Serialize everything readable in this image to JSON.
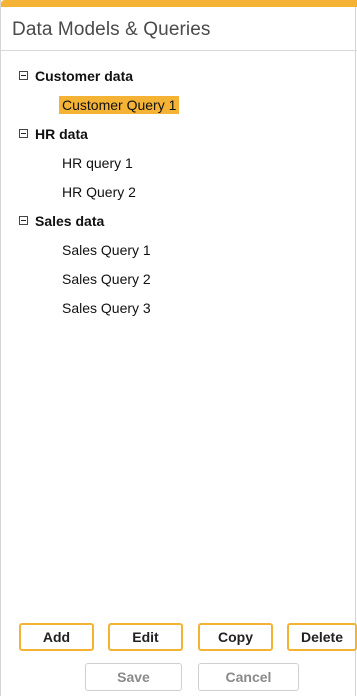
{
  "header": {
    "title": "Data Models & Queries"
  },
  "tree": {
    "groups": [
      {
        "label": "Customer data",
        "expanded": true,
        "items": [
          {
            "label": "Customer Query 1",
            "selected": true
          }
        ]
      },
      {
        "label": "HR data",
        "expanded": true,
        "items": [
          {
            "label": "HR query 1",
            "selected": false
          },
          {
            "label": "HR Query 2",
            "selected": false
          }
        ]
      },
      {
        "label": "Sales data",
        "expanded": true,
        "items": [
          {
            "label": "Sales Query 1",
            "selected": false
          },
          {
            "label": "Sales Query 2",
            "selected": false
          },
          {
            "label": "Sales Query 3",
            "selected": false
          }
        ]
      }
    ]
  },
  "actions": {
    "add_label": "Add",
    "edit_label": "Edit",
    "copy_label": "Copy",
    "delete_label": "Delete",
    "save_label": "Save",
    "cancel_label": "Cancel"
  },
  "colors": {
    "accent": "#f5b335",
    "border": "#d4d4d4",
    "disabled_text": "#8a8a8a"
  }
}
